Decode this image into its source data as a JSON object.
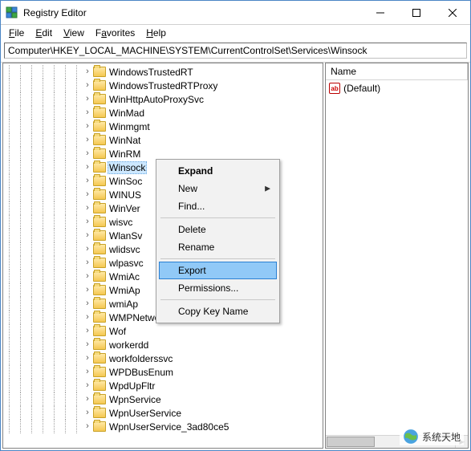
{
  "titlebar": {
    "title": "Registry Editor"
  },
  "menubar": {
    "file": "File",
    "file_u": "F",
    "edit": "Edit",
    "edit_u": "E",
    "view": "View",
    "view_u": "V",
    "fav": "Favorites",
    "fav_u": "a",
    "help": "Help",
    "help_u": "H"
  },
  "address": {
    "value": "Computer\\HKEY_LOCAL_MACHINE\\SYSTEM\\CurrentControlSet\\Services\\Winsock"
  },
  "tree": {
    "items": [
      {
        "label": "WindowsTrustedRT"
      },
      {
        "label": "WindowsTrustedRTProxy"
      },
      {
        "label": "WinHttpAutoProxySvc"
      },
      {
        "label": "WinMad"
      },
      {
        "label": "Winmgmt"
      },
      {
        "label": "WinNat"
      },
      {
        "label": "WinRM"
      },
      {
        "label": "Winsock",
        "selected": true
      },
      {
        "label": "WinSoc"
      },
      {
        "label": "WINUS"
      },
      {
        "label": "WinVer"
      },
      {
        "label": "wisvc"
      },
      {
        "label": "WlanSv"
      },
      {
        "label": "wlidsvc"
      },
      {
        "label": "wlpasvc"
      },
      {
        "label": "WmiAc"
      },
      {
        "label": "WmiAp"
      },
      {
        "label": "wmiAp"
      },
      {
        "label": "WMPNetworksvc"
      },
      {
        "label": "Wof"
      },
      {
        "label": "workerdd"
      },
      {
        "label": "workfolderssvc"
      },
      {
        "label": "WPDBusEnum"
      },
      {
        "label": "WpdUpFltr"
      },
      {
        "label": "WpnService"
      },
      {
        "label": "WpnUserService"
      },
      {
        "label": "WpnUserService_3ad80ce5"
      }
    ]
  },
  "contextmenu": {
    "expand": "Expand",
    "new": "New",
    "find": "Find...",
    "delete": "Delete",
    "rename": "Rename",
    "export": "Export",
    "permissions": "Permissions...",
    "copykey": "Copy Key Name"
  },
  "list": {
    "header_name": "Name",
    "default": "(Default)"
  },
  "watermark": {
    "text": "系统天地"
  }
}
